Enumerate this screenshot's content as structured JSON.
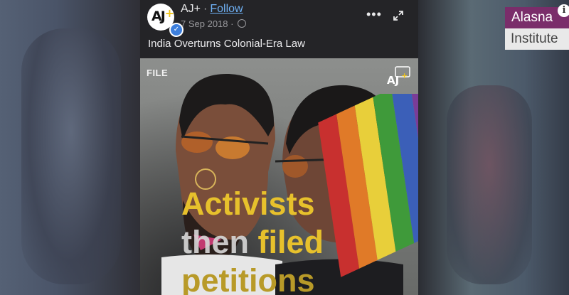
{
  "post": {
    "author": "AJ+",
    "separator": "·",
    "follow_label": "Follow",
    "date": "7 Sep 2018",
    "meta_separator": "·",
    "caption": "India Overturns Colonial-Era Law",
    "avatar_logo": "AJ+",
    "icons": [
      "more-options-icon",
      "expand-icon",
      "globe-icon",
      "verified-icon"
    ]
  },
  "video": {
    "file_tag": "FILE",
    "overlay_line1": "Activists",
    "overlay_line2_a": "then",
    "overlay_line2_b": "filed",
    "overlay_line3": "petitions"
  },
  "brand": {
    "top": "Alasna",
    "bottom": "Institute",
    "info": "i"
  },
  "colors": {
    "brand_purple": "#7a2d6a",
    "overlay_yellow": "#e7c12c",
    "follow_link": "#6fb1f5",
    "post_bg": "#232326"
  }
}
